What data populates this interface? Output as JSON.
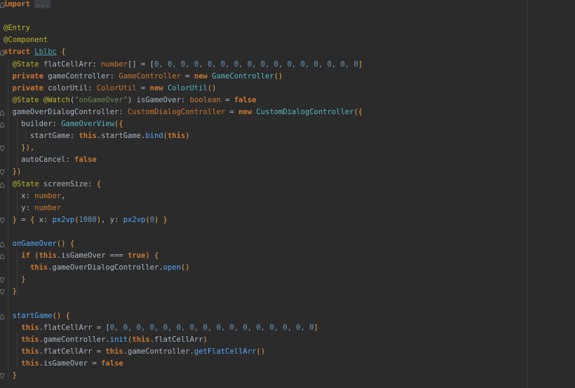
{
  "editor": {
    "lines": [
      {
        "tokens": [
          {
            "t": "import",
            "c": "kw"
          },
          {
            "t": " ",
            "c": "plain"
          },
          {
            "t": "...",
            "c": "folded"
          }
        ],
        "fold": "close"
      },
      {
        "tokens": []
      },
      {
        "tokens": [
          {
            "t": "@Entry",
            "c": "ann"
          }
        ]
      },
      {
        "tokens": [
          {
            "t": "@Component",
            "c": "ann"
          }
        ]
      },
      {
        "tokens": [
          {
            "t": "struct",
            "c": "kw"
          },
          {
            "t": " ",
            "c": "plain"
          },
          {
            "t": "Lblbc",
            "c": "class-u"
          },
          {
            "t": " ",
            "c": "plain"
          },
          {
            "t": "{",
            "c": "punc"
          }
        ],
        "fold": "open"
      },
      {
        "tokens": [
          {
            "t": "  ",
            "c": "plain"
          },
          {
            "t": "@State",
            "c": "ann"
          },
          {
            "t": " flatCellArr: ",
            "c": "plain"
          },
          {
            "t": "number",
            "c": "type"
          },
          {
            "t": "[] = [",
            "c": "plain"
          },
          {
            "t": "0, 0, 0, 0, 0, 0, 0, 0, 0, 0, 0, 0, 0, 0, 0, 0",
            "c": "num"
          },
          {
            "t": "]",
            "c": "punc"
          }
        ]
      },
      {
        "tokens": [
          {
            "t": "  ",
            "c": "plain"
          },
          {
            "t": "private",
            "c": "kw"
          },
          {
            "t": " gameController: ",
            "c": "plain"
          },
          {
            "t": "GameController",
            "c": "type"
          },
          {
            "t": " = ",
            "c": "plain"
          },
          {
            "t": "new",
            "c": "kw"
          },
          {
            "t": " ",
            "c": "plain"
          },
          {
            "t": "GameController",
            "c": "class"
          },
          {
            "t": "()",
            "c": "punc"
          }
        ]
      },
      {
        "tokens": [
          {
            "t": "  ",
            "c": "plain"
          },
          {
            "t": "private",
            "c": "kw"
          },
          {
            "t": " colorUtil: ",
            "c": "plain"
          },
          {
            "t": "ColorUtil",
            "c": "type"
          },
          {
            "t": " = ",
            "c": "plain"
          },
          {
            "t": "new",
            "c": "kw"
          },
          {
            "t": " ",
            "c": "plain"
          },
          {
            "t": "ColorUtil",
            "c": "class"
          },
          {
            "t": "()",
            "c": "punc"
          }
        ]
      },
      {
        "tokens": [
          {
            "t": "  ",
            "c": "plain"
          },
          {
            "t": "@State",
            "c": "ann"
          },
          {
            "t": " ",
            "c": "plain"
          },
          {
            "t": "@Watch",
            "c": "ann"
          },
          {
            "t": "(",
            "c": "plain"
          },
          {
            "t": "\"onGameOver\"",
            "c": "str"
          },
          {
            "t": ") isGameOver: ",
            "c": "plain"
          },
          {
            "t": "boolean",
            "c": "type"
          },
          {
            "t": " = ",
            "c": "plain"
          },
          {
            "t": "false",
            "c": "kw"
          }
        ]
      },
      {
        "tokens": [
          {
            "t": "  gameOverDialogController: ",
            "c": "plain"
          },
          {
            "t": "CustomDialogController",
            "c": "type"
          },
          {
            "t": " = ",
            "c": "plain"
          },
          {
            "t": "new",
            "c": "kw"
          },
          {
            "t": " ",
            "c": "plain"
          },
          {
            "t": "CustomDialogController",
            "c": "class"
          },
          {
            "t": "({",
            "c": "punc"
          }
        ],
        "fold": "open"
      },
      {
        "tokens": [
          {
            "t": "    builder: ",
            "c": "plain"
          },
          {
            "t": "GameOverView",
            "c": "class"
          },
          {
            "t": "({",
            "c": "punc"
          }
        ],
        "fold": "open"
      },
      {
        "tokens": [
          {
            "t": "      startGame: ",
            "c": "plain"
          },
          {
            "t": "this",
            "c": "kw"
          },
          {
            "t": ".startGame.",
            "c": "plain"
          },
          {
            "t": "bind",
            "c": "fn"
          },
          {
            "t": "(",
            "c": "punc"
          },
          {
            "t": "this",
            "c": "kw"
          },
          {
            "t": ")",
            "c": "punc"
          }
        ]
      },
      {
        "tokens": [
          {
            "t": "    ",
            "c": "plain"
          },
          {
            "t": "}),",
            "c": "punc"
          }
        ],
        "fold": "end"
      },
      {
        "tokens": [
          {
            "t": "    autoCancel: ",
            "c": "plain"
          },
          {
            "t": "false",
            "c": "kw"
          }
        ]
      },
      {
        "tokens": [
          {
            "t": "  ",
            "c": "plain"
          },
          {
            "t": "})",
            "c": "punc"
          }
        ],
        "fold": "end"
      },
      {
        "tokens": [
          {
            "t": "  ",
            "c": "plain"
          },
          {
            "t": "@State",
            "c": "ann"
          },
          {
            "t": " screenSize: ",
            "c": "plain"
          },
          {
            "t": "{",
            "c": "punc"
          }
        ],
        "fold": "open"
      },
      {
        "tokens": [
          {
            "t": "    x: ",
            "c": "plain"
          },
          {
            "t": "number",
            "c": "type"
          },
          {
            "t": ",",
            "c": "plain"
          }
        ]
      },
      {
        "tokens": [
          {
            "t": "    y: ",
            "c": "plain"
          },
          {
            "t": "number",
            "c": "type"
          }
        ]
      },
      {
        "tokens": [
          {
            "t": "  ",
            "c": "plain"
          },
          {
            "t": "}",
            "c": "punc"
          },
          {
            "t": " = ",
            "c": "plain"
          },
          {
            "t": "{",
            "c": "punc"
          },
          {
            "t": " x: ",
            "c": "plain"
          },
          {
            "t": "px2vp",
            "c": "fn"
          },
          {
            "t": "(",
            "c": "punc"
          },
          {
            "t": "1080",
            "c": "num"
          },
          {
            "t": ")",
            "c": "punc"
          },
          {
            "t": ", y: ",
            "c": "plain"
          },
          {
            "t": "px2vp",
            "c": "fn"
          },
          {
            "t": "(",
            "c": "punc"
          },
          {
            "t": "0",
            "c": "num"
          },
          {
            "t": ")",
            "c": "punc"
          },
          {
            "t": " }",
            "c": "punc"
          }
        ],
        "fold": "end"
      },
      {
        "tokens": []
      },
      {
        "tokens": [
          {
            "t": "  ",
            "c": "plain"
          },
          {
            "t": "onGameOver",
            "c": "fn"
          },
          {
            "t": "() ",
            "c": "punc"
          },
          {
            "t": "{",
            "c": "punc"
          }
        ],
        "fold": "open"
      },
      {
        "tokens": [
          {
            "t": "    ",
            "c": "plain"
          },
          {
            "t": "if",
            "c": "kw"
          },
          {
            "t": " (",
            "c": "punc"
          },
          {
            "t": "this",
            "c": "kw"
          },
          {
            "t": ".isGameOver === ",
            "c": "plain"
          },
          {
            "t": "true",
            "c": "kw"
          },
          {
            "t": ") ",
            "c": "punc"
          },
          {
            "t": "{",
            "c": "punc"
          }
        ],
        "fold": "open"
      },
      {
        "tokens": [
          {
            "t": "      ",
            "c": "plain"
          },
          {
            "t": "this",
            "c": "kw"
          },
          {
            "t": ".gameOverDialogController.",
            "c": "plain"
          },
          {
            "t": "open",
            "c": "fn"
          },
          {
            "t": "()",
            "c": "punc"
          }
        ]
      },
      {
        "tokens": [
          {
            "t": "    ",
            "c": "plain"
          },
          {
            "t": "}",
            "c": "punc"
          }
        ],
        "fold": "end"
      },
      {
        "tokens": [
          {
            "t": "  ",
            "c": "plain"
          },
          {
            "t": "}",
            "c": "punc"
          }
        ],
        "fold": "end"
      },
      {
        "tokens": []
      },
      {
        "tokens": [
          {
            "t": "  ",
            "c": "plain"
          },
          {
            "t": "startGame",
            "c": "fn"
          },
          {
            "t": "() ",
            "c": "punc"
          },
          {
            "t": "{",
            "c": "punc"
          }
        ],
        "fold": "open"
      },
      {
        "tokens": [
          {
            "t": "    ",
            "c": "plain"
          },
          {
            "t": "this",
            "c": "kw"
          },
          {
            "t": ".flatCellArr = [",
            "c": "plain"
          },
          {
            "t": "0, 0, 0, 0, 0, 0, 0, 0, 0, 0, 0, 0, 0, 0, 0, 0",
            "c": "num"
          },
          {
            "t": "]",
            "c": "punc"
          }
        ]
      },
      {
        "tokens": [
          {
            "t": "    ",
            "c": "plain"
          },
          {
            "t": "this",
            "c": "kw"
          },
          {
            "t": ".gameController.",
            "c": "plain"
          },
          {
            "t": "init",
            "c": "fn"
          },
          {
            "t": "(",
            "c": "punc"
          },
          {
            "t": "this",
            "c": "kw"
          },
          {
            "t": ".flatCellArr",
            "c": "plain"
          },
          {
            "t": ")",
            "c": "punc"
          }
        ]
      },
      {
        "tokens": [
          {
            "t": "    ",
            "c": "plain"
          },
          {
            "t": "this",
            "c": "kw"
          },
          {
            "t": ".flatCellArr = ",
            "c": "plain"
          },
          {
            "t": "this",
            "c": "kw"
          },
          {
            "t": ".gameController.",
            "c": "plain"
          },
          {
            "t": "getFlatCellArr",
            "c": "fn"
          },
          {
            "t": "()",
            "c": "punc"
          }
        ]
      },
      {
        "tokens": [
          {
            "t": "    ",
            "c": "plain"
          },
          {
            "t": "this",
            "c": "kw"
          },
          {
            "t": ".isGameOver = ",
            "c": "plain"
          },
          {
            "t": "false",
            "c": "kw"
          }
        ]
      },
      {
        "tokens": [
          {
            "t": "  ",
            "c": "plain"
          },
          {
            "t": "}",
            "c": "punc"
          }
        ],
        "fold": "end"
      }
    ]
  }
}
